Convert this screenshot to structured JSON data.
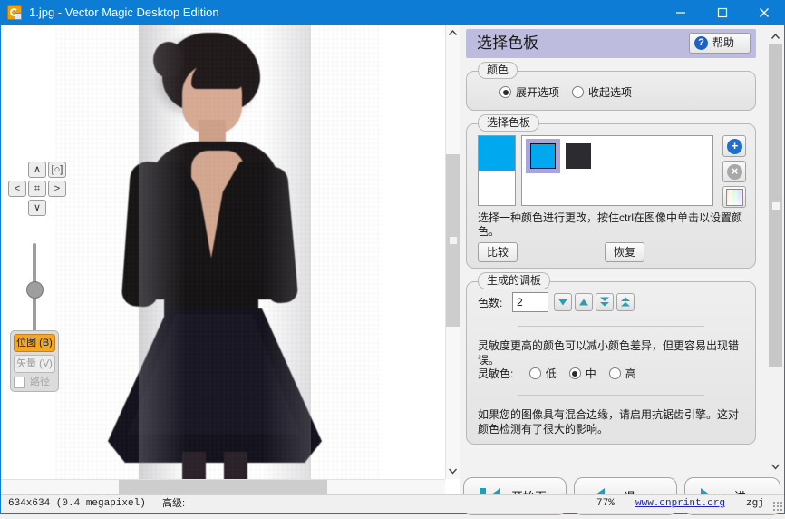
{
  "window": {
    "title": "1.jpg - Vector Magic Desktop Edition",
    "icon": "app-icon",
    "minimize_label": "–",
    "maximize_label": "□",
    "close_label": "✕",
    "accent_color": "#0c7cd5"
  },
  "canvas": {
    "nav_pad": {
      "up": "∧",
      "down": "∨",
      "left": "<",
      "right": ">",
      "center": "⌗",
      "fit": "[○]"
    },
    "zoom_slider_value": "",
    "mode": {
      "bitmap_label": "位图 (B)",
      "vector_label": "矢量 (V)",
      "path_label": "路径",
      "bitmap_selected": true,
      "vector_selected": false,
      "path_checked": false,
      "active_color": "#f5a623"
    }
  },
  "panel": {
    "header_title": "选择色板",
    "header_bg": "#bdbcdf",
    "help_button": "帮助",
    "help_icon": "question-mark-icon",
    "color_group": {
      "legend": "颜色",
      "options": [
        {
          "label": "展开选项",
          "selected": true
        },
        {
          "label": "收起选项",
          "selected": false
        }
      ]
    },
    "palette_group": {
      "legend": "选择色板",
      "current_color": "#00a8f0",
      "swatches": [
        {
          "color": "#00a8f0",
          "selected": true
        },
        {
          "color": "#2b2b30",
          "selected": false
        }
      ],
      "add_button": "+",
      "delete_button": "×",
      "picker_button": "rainbow-picker-icon",
      "hint": "选择一种颜色进行更改，按住ctrl在图像中单击以设置颜色。",
      "compare_button": "比较",
      "restore_button": "恢复"
    },
    "generated_group": {
      "legend": "生成的调板",
      "count_label": "色数:",
      "count_value": "2",
      "spin_down": "▼",
      "spin_up": "▲",
      "spin_down_fast": "▼▼",
      "spin_up_fast": "▲▲",
      "sensitivity_desc": "灵敏度更高的颜色可以减小颜色差异，但更容易出现错误。",
      "sensitivity_label": "灵敏色:",
      "sensitivity_options": [
        {
          "label": "低",
          "selected": false
        },
        {
          "label": "中",
          "selected": true
        },
        {
          "label": "高",
          "selected": false
        }
      ],
      "antialias_note": "如果您的图像具有混合边缘，请启用抗锯齿引擎。这对颜色检测有了很大的影响。"
    }
  },
  "bottom_nav": {
    "start_label": "开始页",
    "back_label": "退",
    "forward_label": "进",
    "start_icon": "skip-to-start-icon",
    "back_icon": "triangle-left-icon",
    "forward_icon": "triangle-right-icon",
    "icon_color": "#1a9fc0"
  },
  "status_bar": {
    "dimensions": "634x634 (0.4 megapixel)",
    "advanced_label": "高级:",
    "zoom": "77%",
    "link": "www.cnprint.org",
    "user": "zgj"
  }
}
